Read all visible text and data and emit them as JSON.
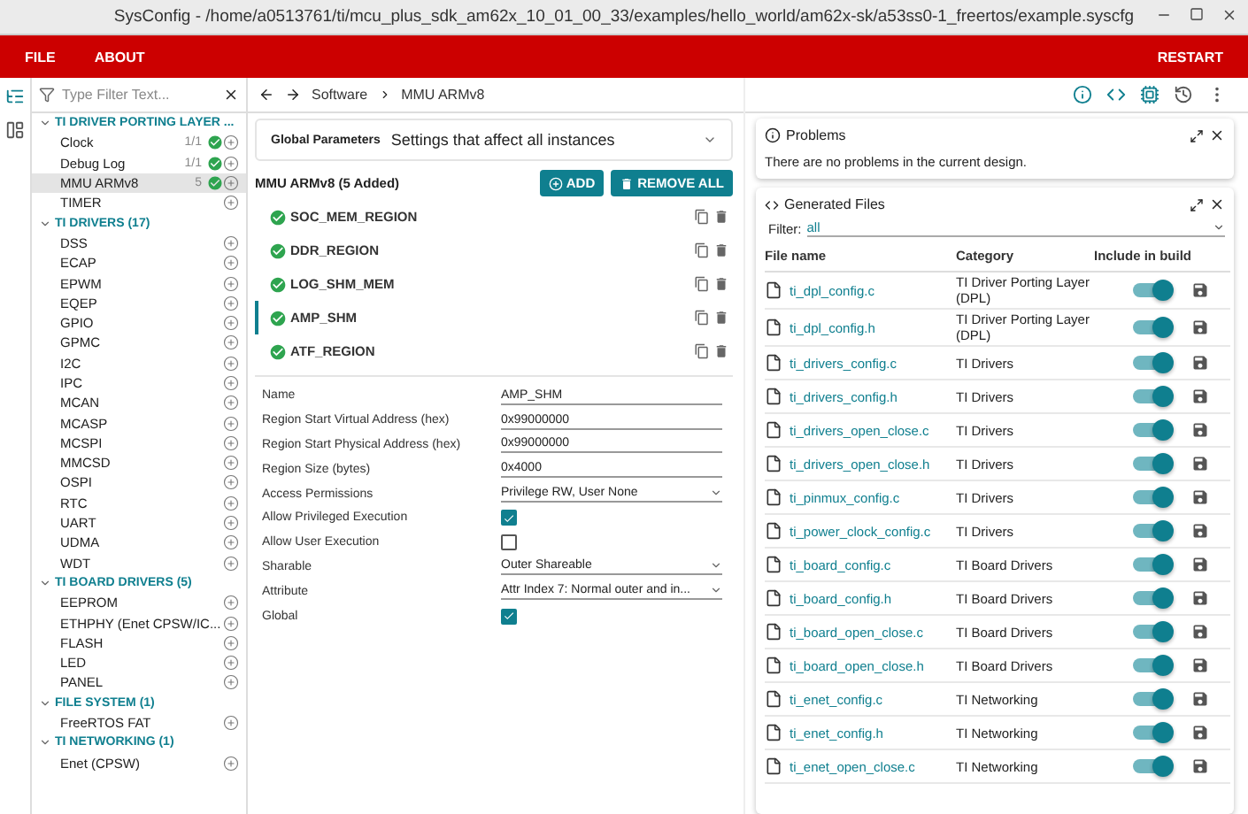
{
  "window": {
    "title": "SysConfig - /home/a0513761/ti/mcu_plus_sdk_am62x_10_01_00_33/examples/hello_world/am62x-sk/a53ss0-1_freertos/example.syscfg"
  },
  "menu": [
    "FILE",
    "ABOUT"
  ],
  "restart": "RESTART",
  "sidebar": {
    "filter_placeholder": "Type Filter Text...",
    "groups": [
      {
        "label": "TI DRIVER PORTING LAYER ...",
        "expanded": true,
        "items": [
          {
            "name": "Clock",
            "count": "1/1",
            "ok": true,
            "selected": false
          },
          {
            "name": "Debug Log",
            "count": "1/1",
            "ok": true,
            "selected": false
          },
          {
            "name": "MMU ARMv8",
            "count": "5",
            "ok": true,
            "selected": true
          },
          {
            "name": "TIMER",
            "ok": false,
            "selected": false
          }
        ]
      },
      {
        "label": "TI DRIVERS (17)",
        "expanded": true,
        "items": [
          {
            "name": "DSS",
            "ok": false,
            "selected": false
          },
          {
            "name": "ECAP",
            "ok": false,
            "selected": false
          },
          {
            "name": "EPWM",
            "ok": false,
            "selected": false
          },
          {
            "name": "EQEP",
            "ok": false,
            "selected": false
          },
          {
            "name": "GPIO",
            "ok": false,
            "selected": false
          },
          {
            "name": "GPMC",
            "ok": false,
            "selected": false
          },
          {
            "name": "I2C",
            "ok": false,
            "selected": false
          },
          {
            "name": "IPC",
            "ok": false,
            "selected": false
          },
          {
            "name": "MCAN",
            "ok": false,
            "selected": false
          },
          {
            "name": "MCASP",
            "ok": false,
            "selected": false
          },
          {
            "name": "MCSPI",
            "ok": false,
            "selected": false
          },
          {
            "name": "MMCSD",
            "ok": false,
            "selected": false
          },
          {
            "name": "OSPI",
            "ok": false,
            "selected": false
          },
          {
            "name": "RTC",
            "ok": false,
            "selected": false
          },
          {
            "name": "UART",
            "ok": false,
            "selected": false
          },
          {
            "name": "UDMA",
            "ok": false,
            "selected": false
          },
          {
            "name": "WDT",
            "ok": false,
            "selected": false
          }
        ]
      },
      {
        "label": "TI BOARD DRIVERS (5)",
        "expanded": true,
        "items": [
          {
            "name": "EEPROM",
            "ok": false,
            "selected": false
          },
          {
            "name": "ETHPHY (Enet CPSW/IC...",
            "ok": false,
            "selected": false
          },
          {
            "name": "FLASH",
            "ok": false,
            "selected": false
          },
          {
            "name": "LED",
            "ok": false,
            "selected": false
          },
          {
            "name": "PANEL",
            "ok": false,
            "selected": false
          }
        ]
      },
      {
        "label": "FILE SYSTEM (1)",
        "expanded": true,
        "items": [
          {
            "name": "FreeRTOS FAT",
            "ok": false,
            "selected": false
          }
        ]
      },
      {
        "label": "TI NETWORKING (1)",
        "expanded": true,
        "items": [
          {
            "name": "Enet (CPSW)",
            "ok": false,
            "selected": false
          }
        ]
      }
    ]
  },
  "breadcrumb": [
    "Software",
    "MMU ARMv8"
  ],
  "global_params": {
    "label": "Global Parameters",
    "description": "Settings that affect all instances"
  },
  "module": {
    "title": "MMU ARMv8 (5 Added)",
    "add": "ADD",
    "remove_all": "REMOVE ALL",
    "instances": [
      {
        "name": "SOC_MEM_REGION",
        "selected": false
      },
      {
        "name": "DDR_REGION",
        "selected": false
      },
      {
        "name": "LOG_SHM_MEM",
        "selected": false
      },
      {
        "name": "AMP_SHM",
        "selected": true
      },
      {
        "name": "ATF_REGION",
        "selected": false
      }
    ]
  },
  "fields": [
    {
      "kind": "text",
      "label": "Name",
      "value": "AMP_SHM"
    },
    {
      "kind": "text",
      "label": "Region Start Virtual Address (hex)",
      "value": "0x99000000"
    },
    {
      "kind": "text",
      "label": "Region Start Physical Address (hex)",
      "value": "0x99000000"
    },
    {
      "kind": "text",
      "label": "Region Size (bytes)",
      "value": "0x4000"
    },
    {
      "kind": "select",
      "label": "Access Permissions",
      "value": "Privilege RW, User None"
    },
    {
      "kind": "checkbox",
      "label": "Allow Privileged Execution",
      "checked": true
    },
    {
      "kind": "checkbox",
      "label": "Allow User Execution",
      "checked": false
    },
    {
      "kind": "select",
      "label": "Sharable",
      "value": "Outer Shareable"
    },
    {
      "kind": "select",
      "label": "Attribute",
      "value": "Attr Index 7: Normal outer and in..."
    },
    {
      "kind": "checkbox",
      "label": "Global",
      "checked": true
    }
  ],
  "problems": {
    "title": "Problems",
    "message": "There are no problems in the current design."
  },
  "generated_files": {
    "title": "Generated Files",
    "filter_label": "Filter:",
    "filter_value": "all",
    "columns": [
      "File name",
      "Category",
      "Include in build"
    ],
    "rows": [
      {
        "name": "ti_dpl_config.c",
        "category": "TI Driver Porting Layer (DPL)",
        "included": true
      },
      {
        "name": "ti_dpl_config.h",
        "category": "TI Driver Porting Layer (DPL)",
        "included": true
      },
      {
        "name": "ti_drivers_config.c",
        "category": "TI Drivers",
        "included": true
      },
      {
        "name": "ti_drivers_config.h",
        "category": "TI Drivers",
        "included": true
      },
      {
        "name": "ti_drivers_open_close.c",
        "category": "TI Drivers",
        "included": true
      },
      {
        "name": "ti_drivers_open_close.h",
        "category": "TI Drivers",
        "included": true
      },
      {
        "name": "ti_pinmux_config.c",
        "category": "TI Drivers",
        "included": true
      },
      {
        "name": "ti_power_clock_config.c",
        "category": "TI Drivers",
        "included": true
      },
      {
        "name": "ti_board_config.c",
        "category": "TI Board Drivers",
        "included": true
      },
      {
        "name": "ti_board_config.h",
        "category": "TI Board Drivers",
        "included": true
      },
      {
        "name": "ti_board_open_close.c",
        "category": "TI Board Drivers",
        "included": true
      },
      {
        "name": "ti_board_open_close.h",
        "category": "TI Board Drivers",
        "included": true
      },
      {
        "name": "ti_enet_config.c",
        "category": "TI Networking",
        "included": true
      },
      {
        "name": "ti_enet_config.h",
        "category": "TI Networking",
        "included": true
      },
      {
        "name": "ti_enet_open_close.c",
        "category": "TI Networking",
        "included": true
      }
    ]
  }
}
